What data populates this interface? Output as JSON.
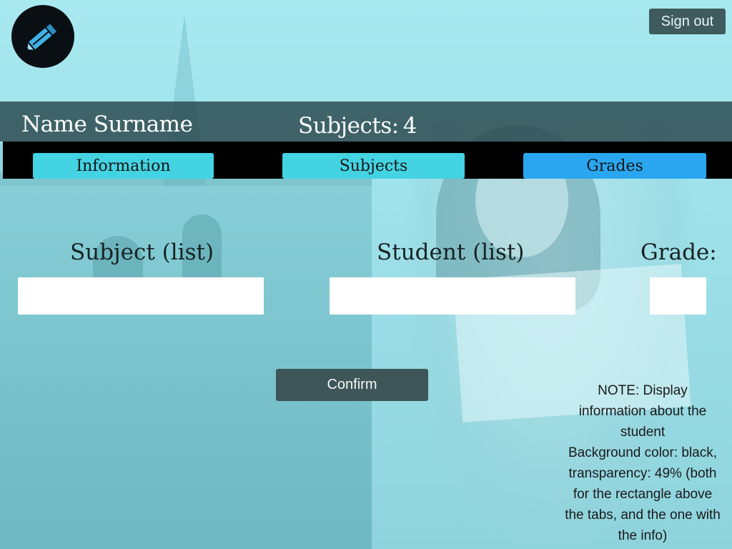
{
  "header": {
    "user_name": "Name Surname",
    "subjects_label": "Subjects:",
    "subjects_count": "4",
    "sign_out_label": "Sign out"
  },
  "logo": {
    "icon": "pencil-icon"
  },
  "tabs": [
    {
      "label": "Information",
      "active": false
    },
    {
      "label": "Subjects",
      "active": false
    },
    {
      "label": "Grades",
      "active": true
    }
  ],
  "form": {
    "subject_label": "Subject (list)",
    "student_label": "Student (list)",
    "grade_label": "Grade:",
    "subject_value": "",
    "student_value": "",
    "grade_value": "",
    "confirm_label": "Confirm"
  },
  "note": {
    "lines": [
      "NOTE: Display",
      "information about the",
      "student",
      "Background color: black,",
      "transparency: 49% (both",
      "for the rectangle above",
      "the tabs, and the one with",
      "the info)"
    ]
  },
  "colors": {
    "tab_default": "#44d3e3",
    "tab_active": "#2aa6f0",
    "header_band": "#28464b",
    "tab_band": "#000000",
    "button": "#3e5657"
  }
}
